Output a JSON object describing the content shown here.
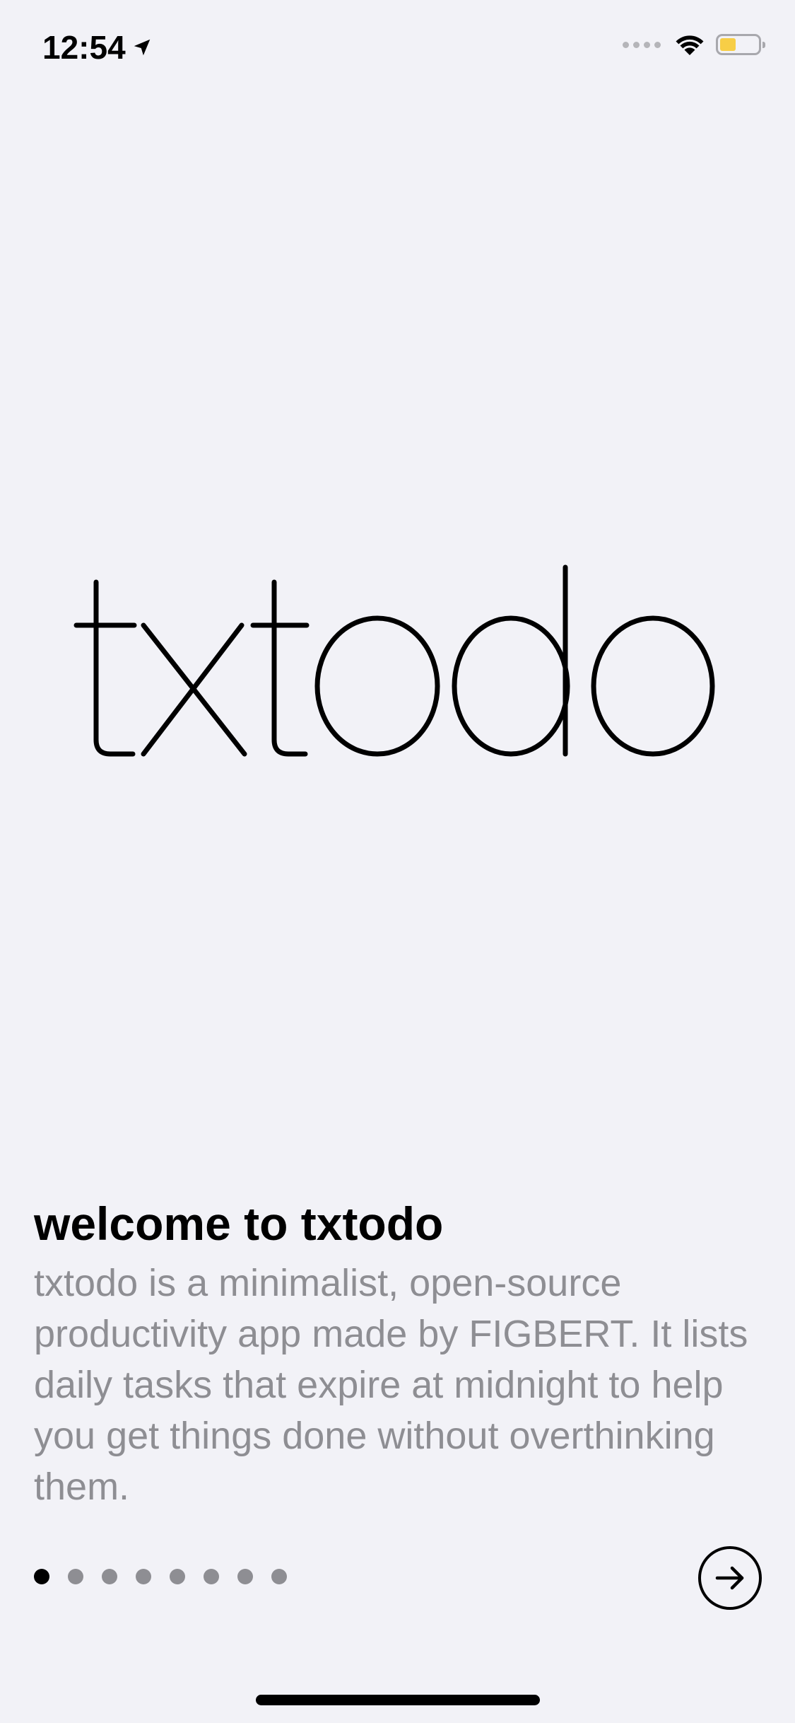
{
  "status_bar": {
    "time": "12:54",
    "location_icon": "location-arrow-icon",
    "signal_icon": "cellular-signal-icon",
    "wifi_icon": "wifi-icon",
    "battery_icon": "battery-icon",
    "battery_color": "#f7ce46"
  },
  "logo": {
    "text": "txtodo"
  },
  "onboarding": {
    "title": "welcome to txtodo",
    "description": "txtodo is a minimalist, open-source productivity app made by FIGBERT. It lists daily tasks that expire at midnight to help you get things done without overthinking them."
  },
  "pager": {
    "page_count": 8,
    "current_page": 1
  },
  "next_button": {
    "icon": "arrow-right-circle-icon"
  },
  "colors": {
    "background": "#f2f2f7",
    "text_primary": "#000000",
    "text_secondary": "#8e8e93"
  }
}
